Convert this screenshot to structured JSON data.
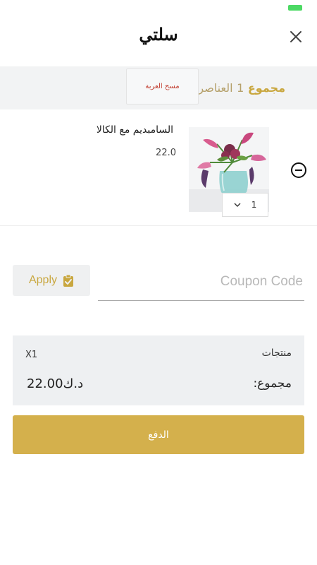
{
  "header": {
    "title": "سلتي",
    "close_icon": "close-icon"
  },
  "summary": {
    "label": "مجموع",
    "count": "1",
    "items_label": "العناصر",
    "clear_cart_label": "مسح العربة"
  },
  "cart": {
    "items": [
      {
        "name": "السامبديم مع الكالا",
        "price": "22.0",
        "quantity": "1",
        "image_icon": "flower-vase-image"
      }
    ]
  },
  "coupon": {
    "placeholder": "Coupon Code",
    "apply_label": "Apply",
    "apply_icon": "clipboard-check-icon"
  },
  "totals": {
    "products_label": "منتجات",
    "products_count": "X1",
    "total_label": "مجموع:",
    "total_value": "د.ك22.00"
  },
  "checkout": {
    "label": "الدفع"
  },
  "colors": {
    "accent": "#c9a73f",
    "button_gold": "#d4b04c",
    "panel_grey": "#eef0f2",
    "danger": "#c0392b",
    "status_green": "#4cd964"
  }
}
